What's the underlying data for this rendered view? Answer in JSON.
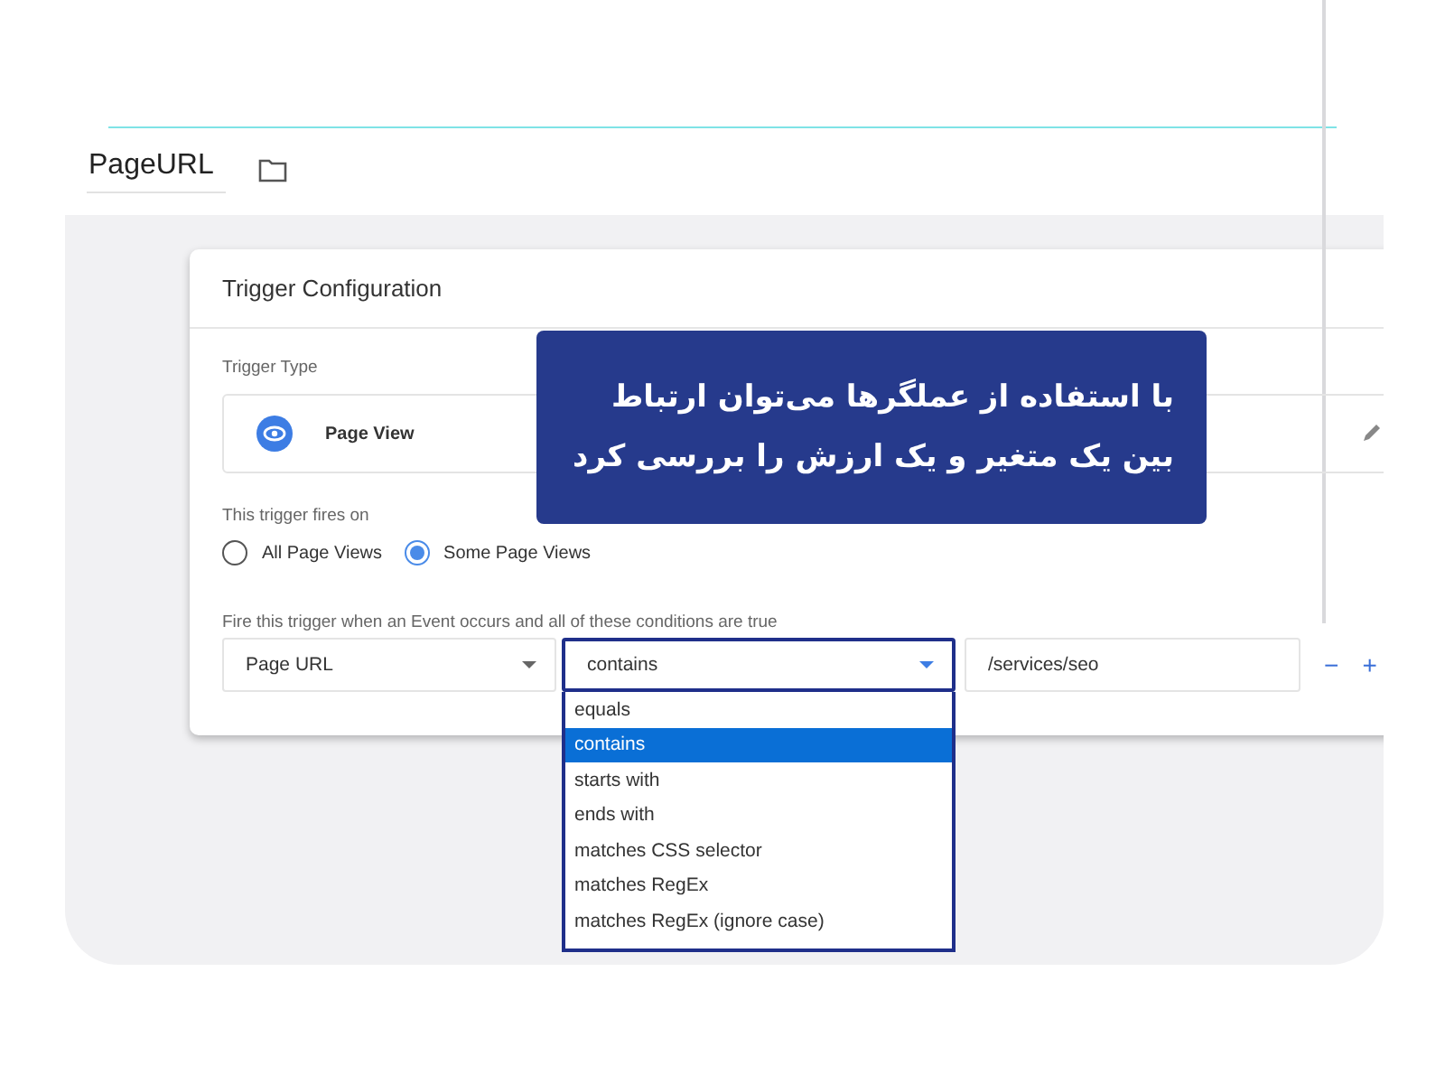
{
  "file": {
    "name": "PageURL"
  },
  "callout": {
    "lines": [
      "با استفاده از عملگرها می‌توان ارتباط",
      "بین یک متغیر و یک ارزش را بررسی کرد"
    ]
  },
  "card": {
    "title": "Trigger Configuration",
    "trigger_type": {
      "label": "Trigger Type",
      "value": "Page View"
    },
    "fires_on": {
      "label": "This trigger fires on",
      "options": [
        {
          "label": "All Page Views",
          "selected": false
        },
        {
          "label": "Some Page Views",
          "selected": true
        }
      ]
    },
    "conditions": {
      "label": "Fire this trigger when an Event occurs and all of these conditions are true",
      "variable": "Page URL",
      "operator": "contains",
      "value": "/services/seo",
      "remove": "−",
      "add": "+",
      "menu": [
        {
          "label": "equals",
          "selected": false
        },
        {
          "label": "contains",
          "selected": true
        },
        {
          "label": "starts with",
          "selected": false
        },
        {
          "label": "ends with",
          "selected": false
        },
        {
          "label": "matches CSS selector",
          "selected": false
        },
        {
          "label": "matches RegEx",
          "selected": false
        },
        {
          "label": "matches RegEx (ignore case)",
          "selected": false
        }
      ]
    }
  }
}
